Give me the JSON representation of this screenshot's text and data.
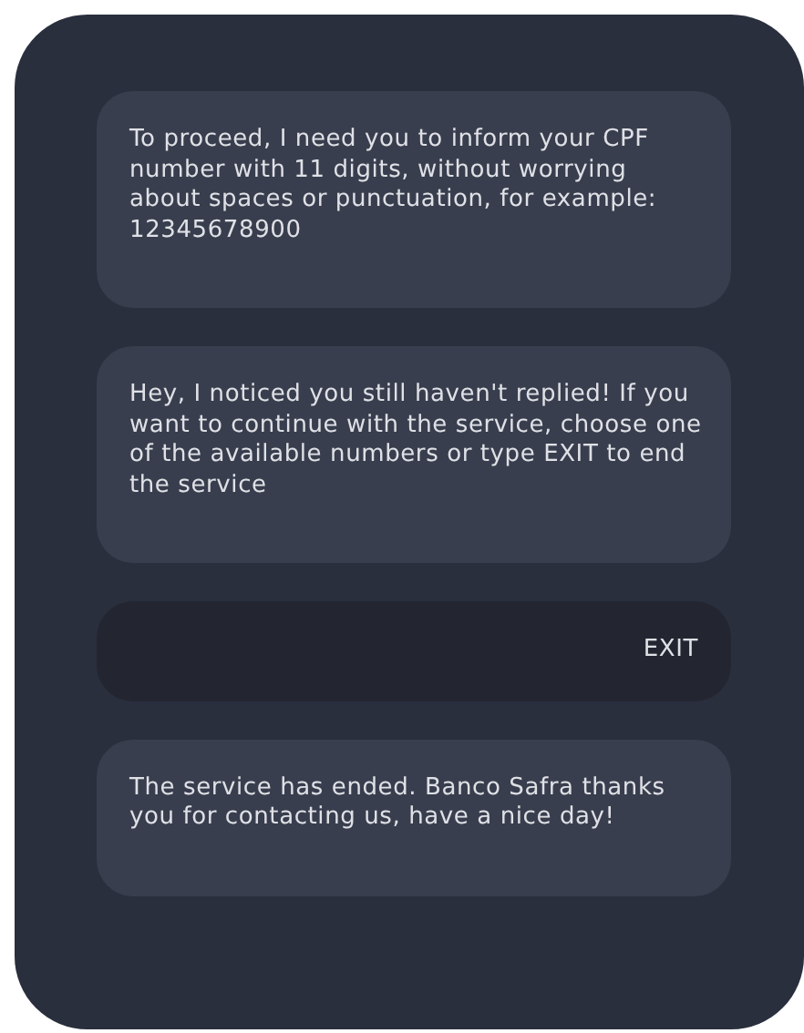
{
  "messages": [
    {
      "kind": "bot",
      "text": "To proceed, I need you to inform your CPF number with 11 digits, without worrying about spaces or punctuation, for example: 12345678900"
    },
    {
      "kind": "bot",
      "text": "Hey, I noticed you still haven't replied! If you want to continue with the service, choose one of the available numbers or type EXIT to end the service"
    },
    {
      "kind": "user",
      "text": "EXIT"
    },
    {
      "kind": "bot",
      "text": "The service has ended. Banco Safra thanks you for contacting us, have a nice day!"
    }
  ]
}
